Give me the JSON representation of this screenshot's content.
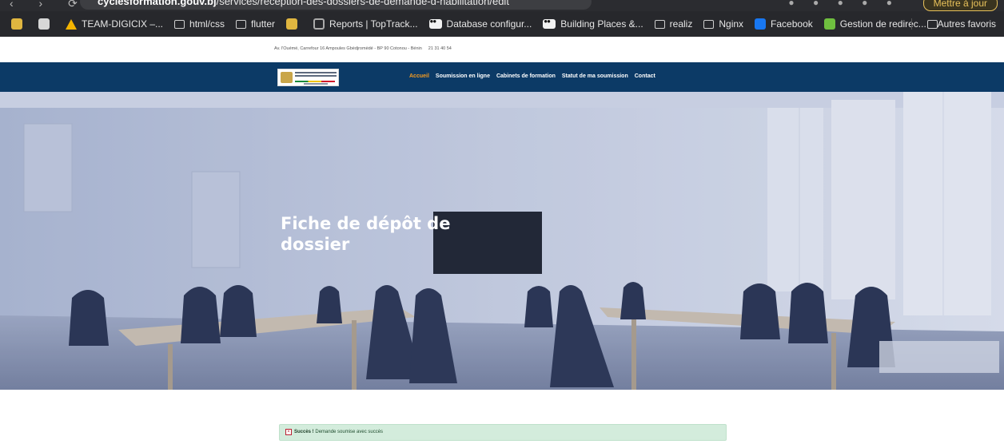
{
  "browser": {
    "address_host": "cyclesformation.gouv.bj",
    "address_path": "/services/reception-des-dossiers-de-demande-d-habilitation/edit",
    "update_label": "Mettre à jour",
    "bookmarks": [
      {
        "label": "",
        "icon": "emblem-icon"
      },
      {
        "label": "",
        "icon": "globe-icon"
      },
      {
        "label": "TEAM-DIGICIX –...",
        "icon": "drive-icon"
      },
      {
        "label": "html/css",
        "icon": "folder-icon"
      },
      {
        "label": "flutter",
        "icon": "folder-icon"
      },
      {
        "label": "",
        "icon": "emblem-icon"
      },
      {
        "label": "Reports | TopTrack...",
        "icon": "circle-icon"
      },
      {
        "label": "Database configur...",
        "icon": "medium-icon"
      },
      {
        "label": "Building Places &...",
        "icon": "medium-icon"
      },
      {
        "label": "realiz",
        "icon": "folder-icon"
      },
      {
        "label": "Nginx",
        "icon": "folder-icon"
      },
      {
        "label": "Facebook",
        "icon": "facebook-icon"
      },
      {
        "label": "Gestion de redirec...",
        "icon": "green-icon"
      }
    ],
    "other_bookmarks": "Autres favoris"
  },
  "topbar": {
    "address": "Av. l'Ouémé, Carrefour 16 Ampoules Gbèdjromèdé - BP 90 Cotonou - Bénin",
    "phone": "21 31 40 54"
  },
  "nav": {
    "items": [
      {
        "label": "Accueil",
        "active": true
      },
      {
        "label": "Soumission en ligne",
        "active": false
      },
      {
        "label": "Cabinets de formation",
        "active": false
      },
      {
        "label": "Statut de ma soumission",
        "active": false
      },
      {
        "label": "Contact",
        "active": false
      }
    ],
    "active_color": "#f39a21",
    "bar_color": "#0c3a66"
  },
  "hero": {
    "title": "Fiche de dépôt de dossier"
  },
  "alert": {
    "strong": "Succès !",
    "message": " Demande soumise avec succès",
    "close": "×"
  }
}
